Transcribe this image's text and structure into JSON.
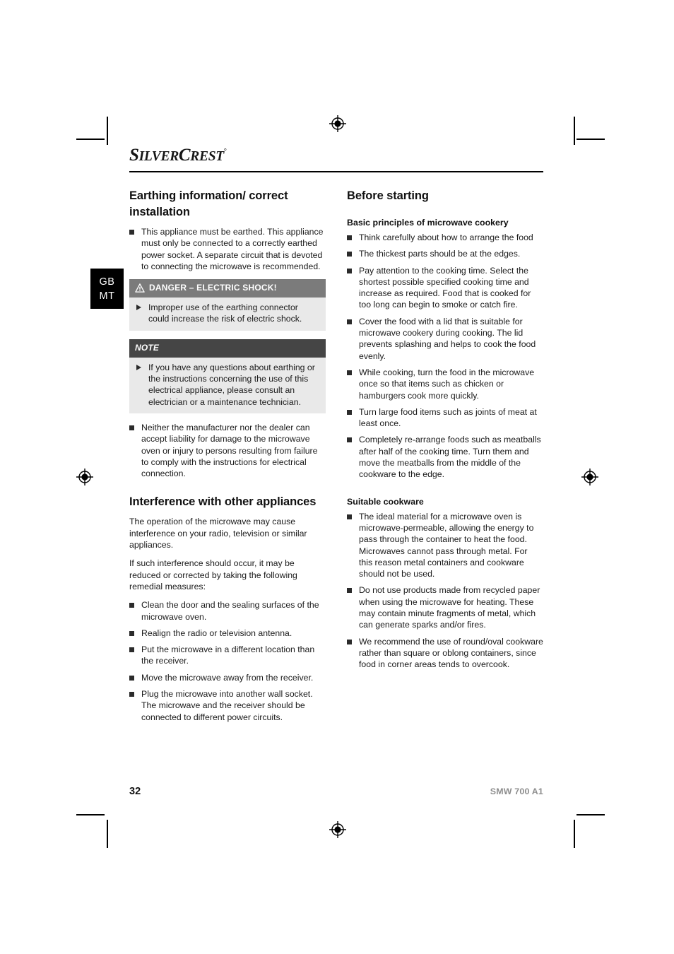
{
  "brand": {
    "name_part1": "S",
    "name_part2": "ILVER",
    "name_part3": "C",
    "name_part4": "REST",
    "registered": "°"
  },
  "locale_tab": {
    "line1": "GB",
    "line2": "MT"
  },
  "left_column": {
    "heading": "Earthing information/ correct installation",
    "bullets_top": [
      "This appliance must be earthed. This appliance must only be connected to a correctly earthed power socket. A separate circuit that is devoted to connecting the microwave is recommended."
    ],
    "danger_callout": {
      "title": "DANGER – ELECTRIC SHOCK!",
      "items": [
        "Improper use of the earthing connector could increase the risk of electric shock."
      ]
    },
    "note_callout": {
      "title": "NOTE",
      "items": [
        "If you have any questions about earthing or the instructions concerning the use of this electrical appliance, please consult an electrician or a maintenance technician."
      ]
    },
    "bullets_after_note": [
      "Neither the manufacturer nor the dealer can accept liability for damage to the microwave oven or injury to persons resulting from failure to comply with the instructions for electrical connection."
    ],
    "heading2": "Interference with other appliances",
    "paragraphs": [
      "The operation of the microwave may cause interference on your radio, television or similar appliances.",
      "If such interference should occur, it may be reduced or corrected by taking the following remedial measures:"
    ],
    "bullets_bottom": [
      "Clean the door and the sealing surfaces of the microwave oven.",
      "Realign the radio or television antenna.",
      "Put the microwave in a different location than the receiver.",
      "Move the microwave away from the receiver.",
      "Plug the microwave into another wall socket. The microwave and the receiver should be connected to different power circuits."
    ]
  },
  "right_column": {
    "heading": "Before starting",
    "subheading1": "Basic principles of microwave cookery",
    "bullets1": [
      "Think carefully about how to arrange the food",
      "The thickest parts should be at the edges.",
      "Pay attention to the cooking time. Select the shortest possible specified cooking time and increase as required. Food that is cooked for too long can begin to smoke or catch fire.",
      "Cover the food with a lid that is suitable for microwave cookery during cooking. The lid prevents splashing and helps to cook the food evenly.",
      "While cooking, turn the food in the microwave once so that items such as chicken or hamburgers cook more quickly.",
      "Turn large food items such as joints of meat at least once.",
      "Completely re-arrange foods such as meatballs after half of the cooking time. Turn them and move the meatballs from the middle of the cookware to the edge."
    ],
    "subheading2": "Suitable cookware",
    "bullets2": [
      "The ideal material for a microwave oven is microwave-permeable, allowing the energy to pass through the container to heat the food. Microwaves cannot pass through metal. For this reason metal containers and cookware should not be used.",
      "Do not use products made from recycled paper when using the microwave for heating. These may contain minute fragments of metal, which can generate sparks and/or fires.",
      "We recommend the use of round/oval cookware rather than square or oblong containers, since food in corner areas tends to overcook."
    ]
  },
  "footer": {
    "page_number": "32",
    "model": "SMW 700 A1"
  },
  "colors": {
    "danger_header_bg": "#7b7b7b",
    "note_header_bg": "#454545",
    "callout_body_bg": "#e9e9e9",
    "locale_tab_bg": "#000000",
    "model_text": "#8d8d8d"
  }
}
